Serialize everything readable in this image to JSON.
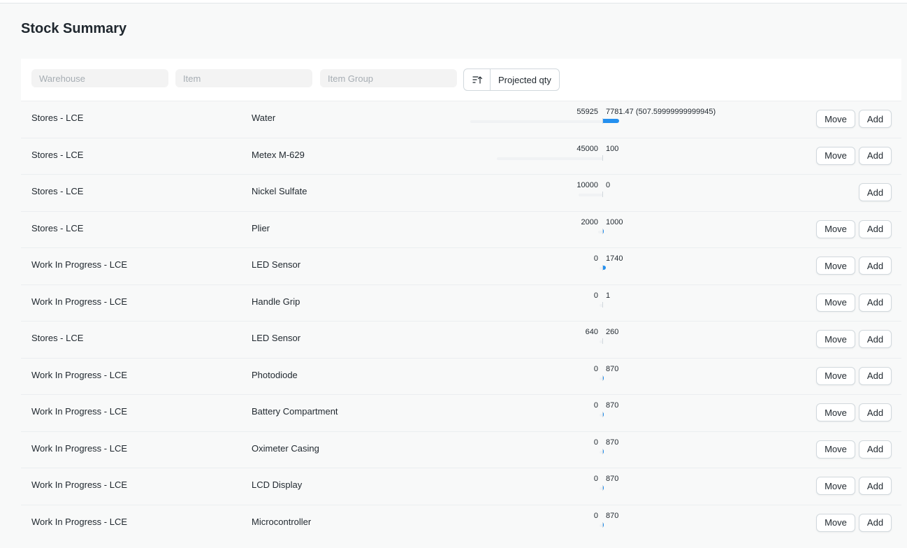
{
  "page": {
    "title": "Stock Summary"
  },
  "filters": {
    "warehouse_placeholder": "Warehouse",
    "item_placeholder": "Item",
    "item_group_placeholder": "Item Group",
    "sort_label": "Projected qty"
  },
  "actions": {
    "move_label": "Move",
    "add_label": "Add"
  },
  "colors": {
    "accent": "#2490ef",
    "bar_bg": "#f0f2f4"
  },
  "rows": [
    {
      "warehouse": "Stores - LCE",
      "item": "Water",
      "actual_qty": "55925",
      "projected_qty": "7781.47 (507.59999999999945)",
      "left_frac": 0.9,
      "right_frac": 0.12,
      "move": true
    },
    {
      "warehouse": "Stores - LCE",
      "item": "Metex M-629",
      "actual_qty": "45000",
      "projected_qty": "100",
      "left_frac": 0.72,
      "right_frac": 0.0,
      "move": true
    },
    {
      "warehouse": "Stores - LCE",
      "item": "Nickel Sulfate",
      "actual_qty": "10000",
      "projected_qty": "0",
      "left_frac": 0.16,
      "right_frac": 0.0,
      "move": false
    },
    {
      "warehouse": "Stores - LCE",
      "item": "Plier",
      "actual_qty": "2000",
      "projected_qty": "1000",
      "left_frac": 0.03,
      "right_frac": 0.01,
      "move": true
    },
    {
      "warehouse": "Work In Progress - LCE",
      "item": "LED Sensor",
      "actual_qty": "0",
      "projected_qty": "1740",
      "left_frac": 0.02,
      "right_frac": 0.025,
      "move": true
    },
    {
      "warehouse": "Work In Progress - LCE",
      "item": "Handle Grip",
      "actual_qty": "0",
      "projected_qty": "1",
      "left_frac": 0.02,
      "right_frac": 0.0,
      "move": true
    },
    {
      "warehouse": "Stores - LCE",
      "item": "LED Sensor",
      "actual_qty": "640",
      "projected_qty": "260",
      "left_frac": 0.01,
      "right_frac": 0.0,
      "move": true
    },
    {
      "warehouse": "Work In Progress - LCE",
      "item": "Photodiode",
      "actual_qty": "0",
      "projected_qty": "870",
      "left_frac": 0.02,
      "right_frac": 0.01,
      "move": true
    },
    {
      "warehouse": "Work In Progress - LCE",
      "item": "Battery Compartment",
      "actual_qty": "0",
      "projected_qty": "870",
      "left_frac": 0.02,
      "right_frac": 0.01,
      "move": true
    },
    {
      "warehouse": "Work In Progress - LCE",
      "item": "Oximeter Casing",
      "actual_qty": "0",
      "projected_qty": "870",
      "left_frac": 0.02,
      "right_frac": 0.01,
      "move": true
    },
    {
      "warehouse": "Work In Progress - LCE",
      "item": "LCD Display",
      "actual_qty": "0",
      "projected_qty": "870",
      "left_frac": 0.02,
      "right_frac": 0.01,
      "move": true
    },
    {
      "warehouse": "Work In Progress - LCE",
      "item": "Microcontroller",
      "actual_qty": "0",
      "projected_qty": "870",
      "left_frac": 0.02,
      "right_frac": 0.01,
      "move": true
    }
  ]
}
